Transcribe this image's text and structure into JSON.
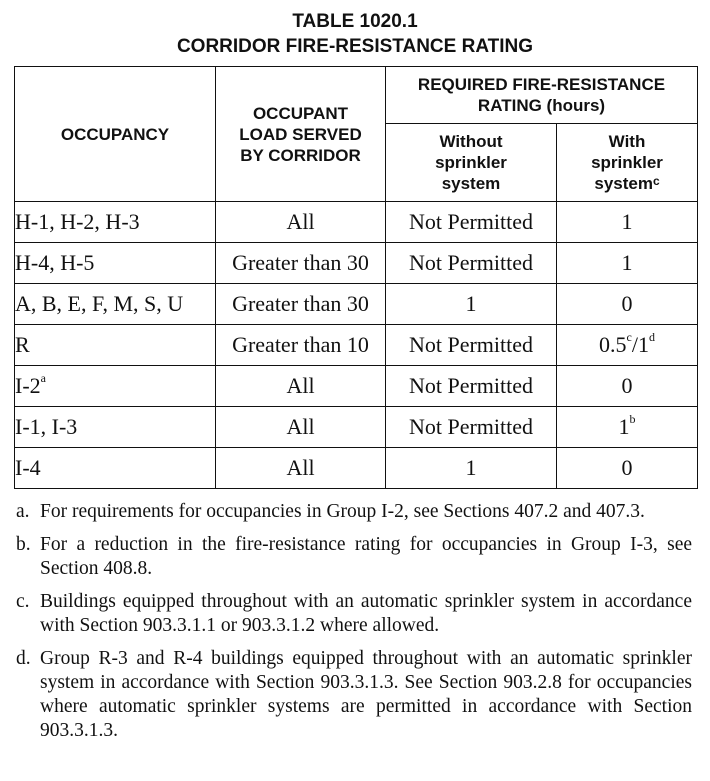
{
  "title": {
    "line1": "TABLE 1020.1",
    "line2": "CORRIDOR FIRE-RESISTANCE RATING"
  },
  "table": {
    "headers": {
      "occupancy": "OCCUPANCY",
      "occupant_load": "OCCUPANT LOAD SERVED BY CORRIDOR",
      "required_rating": "REQUIRED FIRE-RESISTANCE RATING (hours)",
      "without_sprinkler": "Without sprinkler system",
      "with_sprinkler": "With sprinkler system",
      "with_sprinkler_note": "c"
    },
    "rows": [
      {
        "occupancy": "H-1, H-2, H-3",
        "occupancy_note": "",
        "load": "All",
        "without": "Not Permitted",
        "with": "1",
        "with_note": ""
      },
      {
        "occupancy": "H-4, H-5",
        "occupancy_note": "",
        "load": "Greater than 30",
        "without": "Not Permitted",
        "with": "1",
        "with_note": ""
      },
      {
        "occupancy": "A, B, E, F, M, S, U",
        "occupancy_note": "",
        "load": "Greater than 30",
        "without": "1",
        "with": "0",
        "with_note": ""
      },
      {
        "occupancy": "R",
        "occupancy_note": "",
        "load": "Greater than 10",
        "without": "Not Permitted",
        "with": "0.5",
        "with_note": "c",
        "with_extra": "/1",
        "with_extra_note": "d"
      },
      {
        "occupancy": "I-2",
        "occupancy_note": "a",
        "load": "All",
        "without": "Not Permitted",
        "with": "0",
        "with_note": ""
      },
      {
        "occupancy": "I-1, I-3",
        "occupancy_note": "",
        "load": "All",
        "without": "Not Permitted",
        "with": "1",
        "with_note": "b"
      },
      {
        "occupancy": "I-4",
        "occupancy_note": "",
        "load": "All",
        "without": "1",
        "with": "0",
        "with_note": ""
      }
    ]
  },
  "footnotes": [
    {
      "label": "a.",
      "text": "For requirements for occupancies in Group I-2, see Sections 407.2 and 407.3."
    },
    {
      "label": "b.",
      "text": "For a reduction in the fire-resistance rating for occupancies in Group I-3, see Section 408.8."
    },
    {
      "label": "c.",
      "text": "Buildings equipped throughout with an automatic sprinkler system in accordance with Section 903.3.1.1 or 903.3.1.2 where allowed."
    },
    {
      "label": "d.",
      "text": "Group R-3 and R-4 buildings equipped throughout with an automatic sprinkler system in accordance with Section 903.3.1.3. See Section 903.2.8 for occupancies where automatic sprinkler systems are permitted in accordance with Section 903.3.1.3."
    }
  ]
}
